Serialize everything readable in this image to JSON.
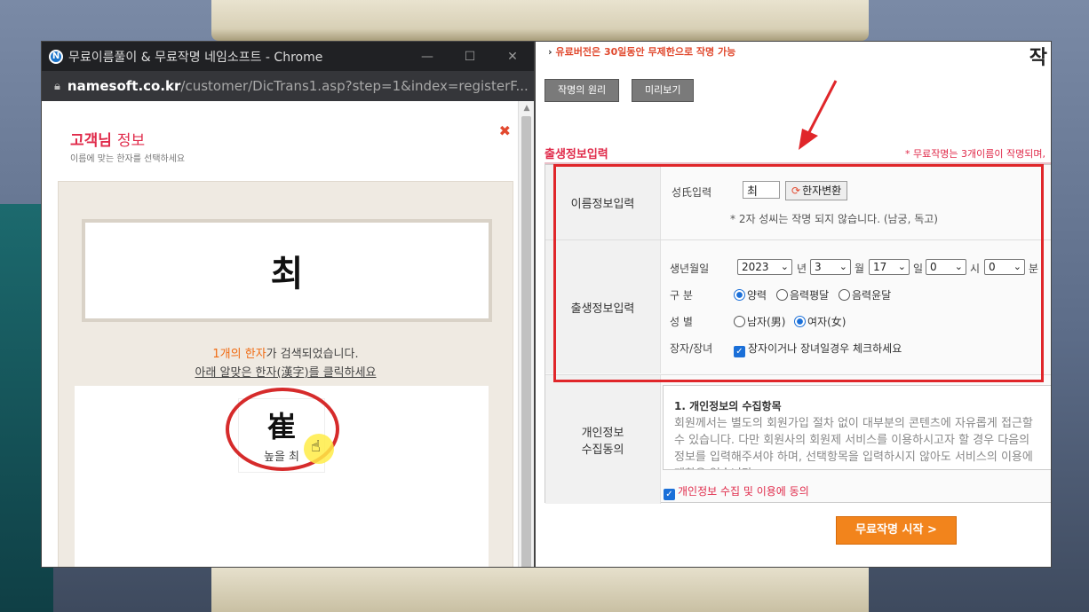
{
  "popup": {
    "window_title": "무료이름풀이 & 무료작명 네임소프트 - Chrome",
    "url_host": "namesoft.co.kr",
    "url_path": "/customer/DicTrans1.asp?step=1&index=registerF...",
    "title_bold": "고객님",
    "title_rest": "정보",
    "subtitle": "이름에 맞는 한자를 선택하세요",
    "close_icon": "close-icon",
    "search_name": "최",
    "found_count": "1개의",
    "found_word": "한자",
    "found_rest": "가 검색되었습니다.",
    "click_hint": "아래 알맞은 한자(漢字)를 클릭하세요",
    "hanja": {
      "char": "崔",
      "reading": "높을 최"
    }
  },
  "main": {
    "promo": "유료버전은 30일동안 무제한으로 작명 가능",
    "corner_logo": "작",
    "tabs": [
      "작명의 원리",
      "미리보기"
    ],
    "section_title": "출생정보입력",
    "section_note": "* 무료작명는 3개이름이 작명되며,",
    "name_row": {
      "label": "이름정보입력",
      "surname_label": "성氏입력",
      "surname_value": "최",
      "hanja_button": "한자변환",
      "hint": "* 2자 성씨는 작명 되지 않습니다. (남궁, 독고)"
    },
    "birth_row": {
      "label": "출생정보입력",
      "date_label": "생년월일",
      "year": "2023",
      "year_unit": "년",
      "month": "3",
      "month_unit": "월",
      "day": "17",
      "day_unit": "일",
      "hour": "0",
      "hour_unit": "시",
      "minute": "0",
      "minute_unit": "분",
      "calendar_label": "구 분",
      "calendar_options": [
        "양력",
        "음력평달",
        "음력윤달"
      ],
      "calendar_selected": "양력",
      "gender_label": "성 별",
      "gender_options": [
        "남자(男)",
        "여자(女)"
      ],
      "gender_selected": "여자(女)",
      "eldest_label": "장자/장녀",
      "eldest_text": "장자이거나 장녀일경우 체크하세요",
      "eldest_checked": true
    },
    "privacy_row": {
      "label_line1": "개인정보",
      "label_line2": "수집동의",
      "heading": "1. 개인정보의 수집항목",
      "text": "회원께서는 별도의 회원가입 절차 없이 대부분의 콘텐츠에 자유롭게 접근할 수 있습니다. 다만 회원사의 회원제 서비스를 이용하시고자 할 경우 다음의 정보를 입력해주셔야 하며, 선택항목을 입력하시지 않아도 서비스의 이용에 제한은 없습니다.",
      "consent": "개인정보 수집 및 이용에 동의",
      "consent_checked": true
    },
    "start_button": "무료작명 시작 >"
  },
  "colors": {
    "accent_red": "#e02a4a",
    "annotation_red": "#e0262a",
    "orange": "#f2841c",
    "radio_blue": "#1a6fd8"
  }
}
